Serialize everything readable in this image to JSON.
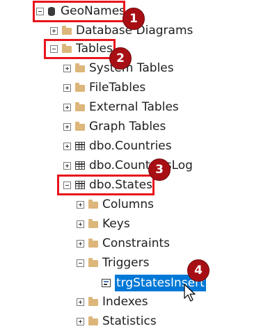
{
  "tree": {
    "geonames": "GeoNames",
    "database_diagrams": "Database Diagrams",
    "tables": "Tables",
    "system_tables": "System Tables",
    "file_tables": "FileTables",
    "external_tables": "External Tables",
    "graph_tables": "Graph Tables",
    "dbo_countries": "dbo.Countries",
    "dbo_countries_log": "dbo.CountriesLog",
    "dbo_states": "dbo.States",
    "columns": "Columns",
    "keys": "Keys",
    "constraints": "Constraints",
    "triggers": "Triggers",
    "trg_states_insert": "trgStatesInsert",
    "indexes": "Indexes",
    "statistics": "Statistics"
  },
  "annotations": {
    "badge_1": "1",
    "badge_2": "2",
    "badge_3": "3",
    "badge_4": "4"
  },
  "colors": {
    "highlight_border": "#e8141c",
    "badge_fill": "#a80f14",
    "selection": "#0078d7",
    "folder": "#dcb67a"
  }
}
